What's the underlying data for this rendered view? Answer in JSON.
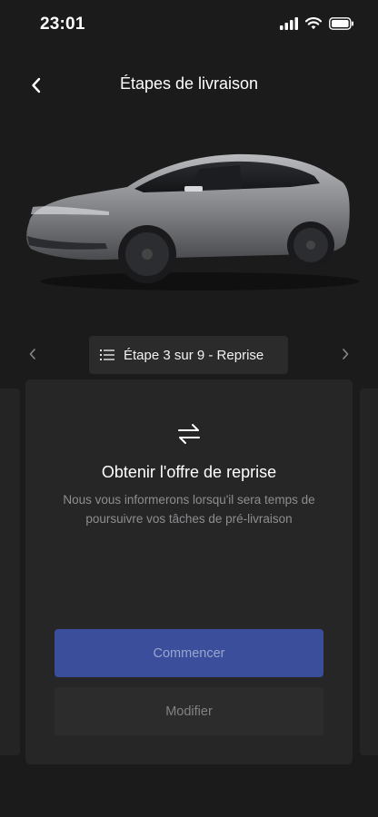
{
  "status_bar": {
    "time": "23:01"
  },
  "nav": {
    "title": "Étapes de livraison"
  },
  "stepper": {
    "label": "Étape 3 sur 9 - Reprise"
  },
  "card": {
    "title": "Obtenir l'offre de reprise",
    "description": "Nous vous informerons lorsqu'il sera temps de poursuivre vos tâches de pré-livraison",
    "primary_button": "Commencer",
    "secondary_button": "Modifier"
  },
  "colors": {
    "background": "#1b1b1c",
    "card": "#262627",
    "primary": "#3a4e9c"
  },
  "icons": {
    "back": "chevron-left-icon",
    "list": "list-icon",
    "prev": "chevron-left-icon",
    "next": "chevron-right-icon",
    "swap": "swap-arrows-icon"
  }
}
